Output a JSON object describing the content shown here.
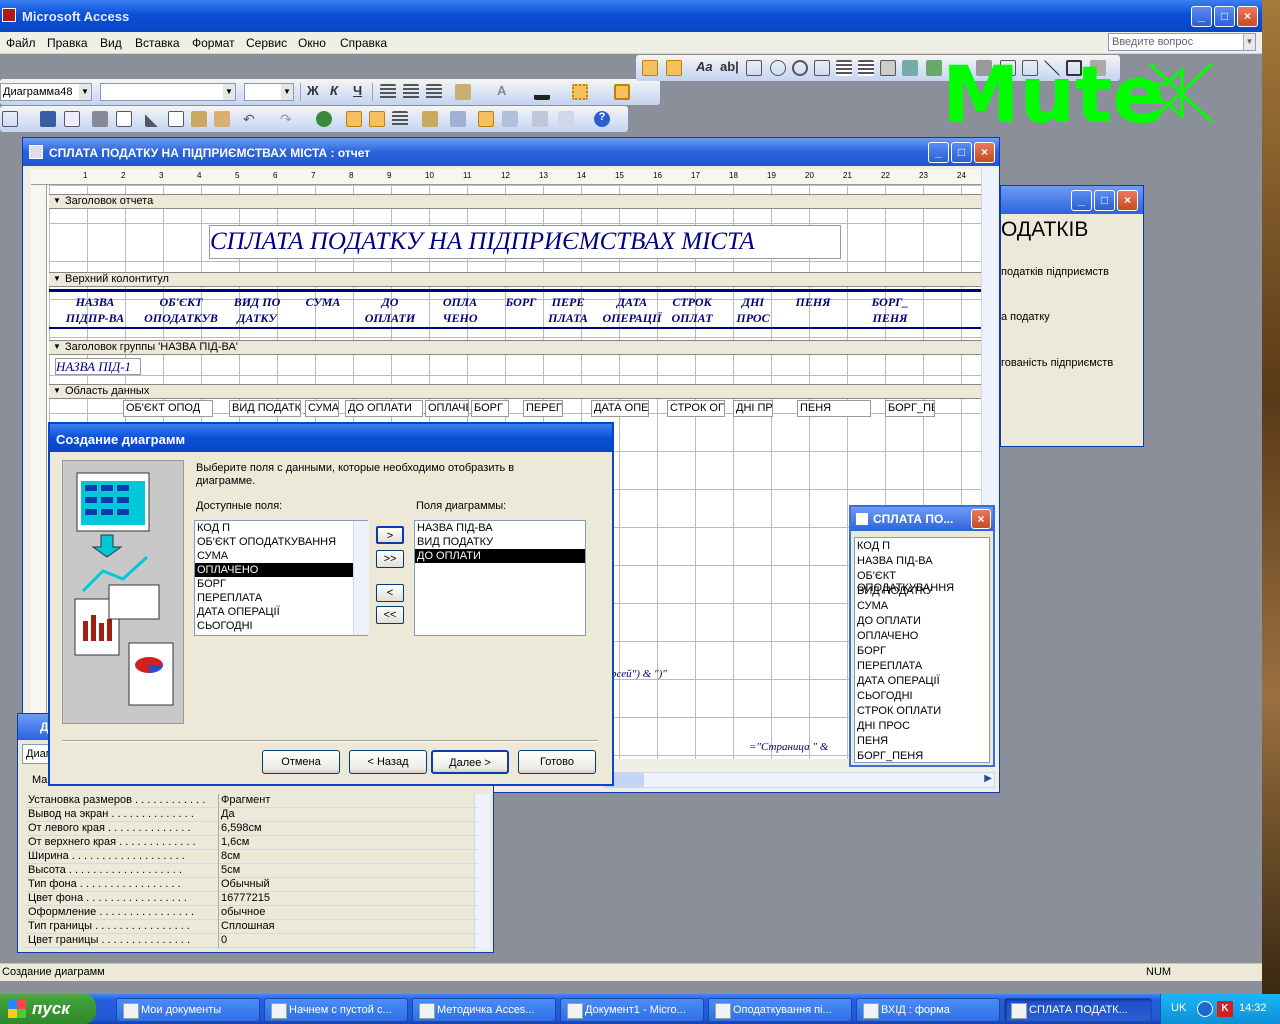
{
  "app": {
    "title": "Microsoft Access"
  },
  "menu": {
    "file": "Файл",
    "edit": "Правка",
    "view": "Вид",
    "insert": "Вставка",
    "format": "Формат",
    "tools": "Сервис",
    "window": "Окно",
    "help": "Справка",
    "ask_placeholder": "Введите вопрос"
  },
  "toolbar": {
    "object_combo": "Диаграмма48",
    "bold": "Ж",
    "italic": "К",
    "underline": "Ч",
    "font_color_glyph": "A"
  },
  "overlay": {
    "mute_text": "Mute"
  },
  "report_window": {
    "title": "СПЛАТА ПОДАТКУ НА ПІДПРИЄМСТВАХ МІСТА : отчет",
    "ruler": [
      "1",
      "2",
      "3",
      "4",
      "5",
      "6",
      "7",
      "8",
      "9",
      "10",
      "11",
      "12",
      "13",
      "14",
      "15",
      "16",
      "17",
      "18",
      "19",
      "20",
      "21",
      "22",
      "23",
      "24"
    ],
    "sections": {
      "report_header": "Заголовок отчета",
      "page_header": "Верхний колонтитул",
      "group_header": "Заголовок группы 'НАЗВА ПІД-ВА'",
      "detail": "Область данных"
    },
    "report_title": "СПЛАТА ПОДАТКУ НА ПІДПРИЄМСТВАХ МІСТА",
    "column_headers": [
      {
        "l1": "НАЗВА",
        "l2": "ПІДПР-ВА"
      },
      {
        "l1": "ОБ'ЄКТ",
        "l2": "ОПОДАТКУВ"
      },
      {
        "l1": "ВИД ПО",
        "l2": "ДАТКУ"
      },
      {
        "l1": "СУМА",
        "l2": ""
      },
      {
        "l1": "ДО",
        "l2": "ОПЛАТИ"
      },
      {
        "l1": "ОПЛА",
        "l2": "ЧЕНО"
      },
      {
        "l1": "БОРГ",
        "l2": ""
      },
      {
        "l1": "ПЕРЕ",
        "l2": "ПЛАТА"
      },
      {
        "l1": "ДАТА",
        "l2": "ОПЕРАЦІЇ"
      },
      {
        "l1": "СТРОК",
        "l2": "ОПЛАТ"
      },
      {
        "l1": "ДНІ",
        "l2": "ПРОС"
      },
      {
        "l1": "ПЕНЯ",
        "l2": ""
      },
      {
        "l1": "БОРГ_",
        "l2": "ПЕНЯ"
      }
    ],
    "group_field": "НАЗВА ПІД-1",
    "detail_fields": [
      "ОБ'ЄКТ ОПОД",
      "ВИД ПОДАТК",
      "СУМА",
      "ДО ОПЛАТИ",
      "ОПЛАЧЕ",
      "БОРГ",
      "ПЕРЕПЛА",
      "ДАТА ОПЕ",
      "СТРОК ОПЛ",
      "ДНІ ПР",
      "ПЕНЯ",
      "БОРГ_ПЕ"
    ],
    "footer_expr1": "рсей\") & \")\"",
    "footer_expr2": "=\"Страница \" &"
  },
  "background_window": {
    "title_fragment": "ОДАТКІВ",
    "items": [
      "податків підприємств",
      "а податку",
      "гованість підприємств"
    ]
  },
  "field_list": {
    "title": "СПЛАТА ПО...",
    "fields": [
      "КОД П",
      "НАЗВА ПІД-ВА",
      "ОБ'ЄКТ ОПОДАТКУВАННЯ",
      "ВИД ПОДАТКУ",
      "СУМА",
      "ДО ОПЛАТИ",
      "ОПЛАЧЕНО",
      "БОРГ",
      "ПЕРЕПЛАТА",
      "ДАТА ОПЕРАЦІЇ",
      "СЬОГОДНІ",
      "СТРОК ОПЛАТИ",
      "ДНІ ПРОС",
      "ПЕНЯ",
      "БОРГ_ПЕНЯ"
    ]
  },
  "property_sheet": {
    "title_fragment": "Д",
    "combo_fragment": "Диаг",
    "tab_fragment": "Ма",
    "rows": [
      {
        "k": "Установка размеров . . . . . . . . . . . .",
        "v": "Фрагмент"
      },
      {
        "k": "Вывод на экран . . . . . . . . . . . . . .",
        "v": "Да"
      },
      {
        "k": "От левого края . . . . . . . . . . . . . .",
        "v": "6,598см"
      },
      {
        "k": "От верхнего края . . . . . . . . . . . . .",
        "v": "1,6см"
      },
      {
        "k": "Ширина . . . . . . . . . . . . . . . . . . .",
        "v": "8см"
      },
      {
        "k": "Высота . . . . . . . . . . . . . . . . . . .",
        "v": "5см"
      },
      {
        "k": "Тип фона . . . . . . . . . . . . . . . . .",
        "v": "Обычный"
      },
      {
        "k": "Цвет фона . . . . . . . . . . . . . . . . .",
        "v": "16777215"
      },
      {
        "k": "Оформление . . . . . . . . . . . . . . . .",
        "v": "обычное"
      },
      {
        "k": "Тип границы . . . . . . . . . . . . . . . .",
        "v": "Сплошная"
      },
      {
        "k": "Цвет границы . . . . . . . . . . . . . . .",
        "v": "0"
      }
    ]
  },
  "wizard": {
    "title": "Создание диаграмм",
    "instruction": "Выберите поля с данными, которые необходимо отобразить в диаграмме.",
    "available_label": "Доступные поля:",
    "chart_fields_label": "Поля диаграммы:",
    "available": [
      "КОД П",
      "ОБ'ЄКТ ОПОДАТКУВАННЯ",
      "СУМА",
      "ОПЛАЧЕНО",
      "БОРГ",
      "ПЕРЕПЛАТА",
      "ДАТА ОПЕРАЦІЇ",
      "СЬОГОДНІ"
    ],
    "available_selected": "ОПЛАЧЕНО",
    "chart_fields": [
      "НАЗВА ПІД-ВА",
      "ВИД ПОДАТКУ",
      "ДО ОПЛАТИ"
    ],
    "chart_selected": "ДО ОПЛАТИ",
    "move_one": ">",
    "move_all": ">>",
    "remove_one": "<",
    "remove_all": "<<",
    "cancel": "Отмена",
    "back": "< Назад",
    "next": "Далее >",
    "finish": "Готово"
  },
  "status_bar": {
    "text": "Создание диаграмм",
    "num": "NUM"
  },
  "taskbar": {
    "start": "пуск",
    "tasks": [
      "Мои документы",
      "Начнем с пустой с...",
      "Методичка Acces...",
      "Документ1 - Micro...",
      "Оподаткування пі...",
      "ВХІД : форма",
      "СПЛАТА ПОДАТК..."
    ],
    "lang": "UK",
    "clock": "14:32"
  },
  "colors": {
    "title_blue": "#0a50d8",
    "report_title": "#000080",
    "mute_green": "#00ff00"
  }
}
